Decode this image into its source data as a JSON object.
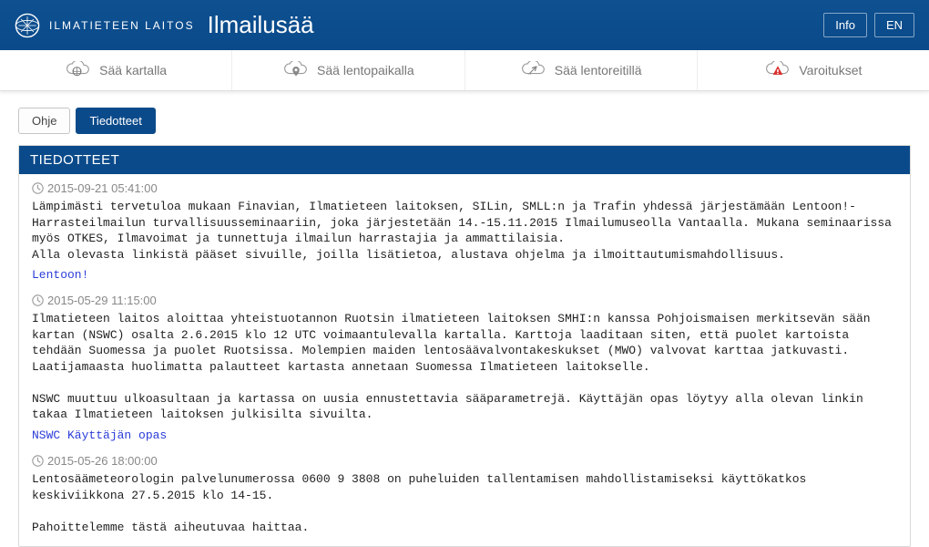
{
  "header": {
    "brand_small": "ILMATIETEEN LAITOS",
    "title": "Ilmailusää",
    "info_btn": "Info",
    "lang_btn": "EN"
  },
  "nav": {
    "map": "Sää kartalla",
    "airport": "Sää lentopaikalla",
    "route": "Sää lentoreitillä",
    "warnings": "Varoitukset"
  },
  "tabs": {
    "help": "Ohje",
    "bulletins": "Tiedotteet"
  },
  "panel": {
    "title": "TIEDOTTEET"
  },
  "entries": [
    {
      "ts": "2015-09-21 05:41:00",
      "body": "Lämpimästi tervetuloa mukaan Finavian, Ilmatieteen laitoksen, SILin, SMLL:n ja Trafin yhdessä järjestämään Lentoon!-Harrasteilmailun turvallisuusseminaariin, joka järjestetään 14.-15.11.2015 Ilmailumuseolla Vantaalla. Mukana seminaarissa myös OTKES, Ilmavoimat ja tunnettuja ilmailun harrastajia ja ammattilaisia.\nAlla olevasta linkistä pääset sivuille, joilla lisätietoa, alustava ohjelma ja ilmoittautumismahdollisuus.",
      "link": "Lentoon!"
    },
    {
      "ts": "2015-05-29 11:15:00",
      "body": "Ilmatieteen laitos aloittaa yhteistuotannon Ruotsin ilmatieteen laitoksen SMHI:n kanssa Pohjoismaisen merkitsevän sään kartan (NSWC) osalta 2.6.2015 klo 12 UTC voimaantulevalla kartalla. Karttoja laaditaan siten, että puolet kartoista tehdään Suomessa ja puolet Ruotsissa. Molempien maiden lentosäävalvontakeskukset (MWO) valvovat karttaa jatkuvasti. Laatijamaasta huolimatta palautteet kartasta annetaan Suomessa Ilmatieteen laitokselle.\n\nNSWC muuttuu ulkoasultaan ja kartassa on uusia ennustettavia sääparametrejä. Käyttäjän opas löytyy alla olevan linkin takaa Ilmatieteen laitoksen julkisilta sivuilta.",
      "link": "NSWC Käyttäjän opas"
    },
    {
      "ts": "2015-05-26 18:00:00",
      "body": "Lentosäämeteorologin palvelunumerossa 0600 9 3808 on puheluiden tallentamisen mahdollistamiseksi käyttökatkos keskiviikkona 27.5.2015 klo 14-15.\n\nPahoittelemme tästä aiheutuvaa haittaa.",
      "link": ""
    }
  ]
}
